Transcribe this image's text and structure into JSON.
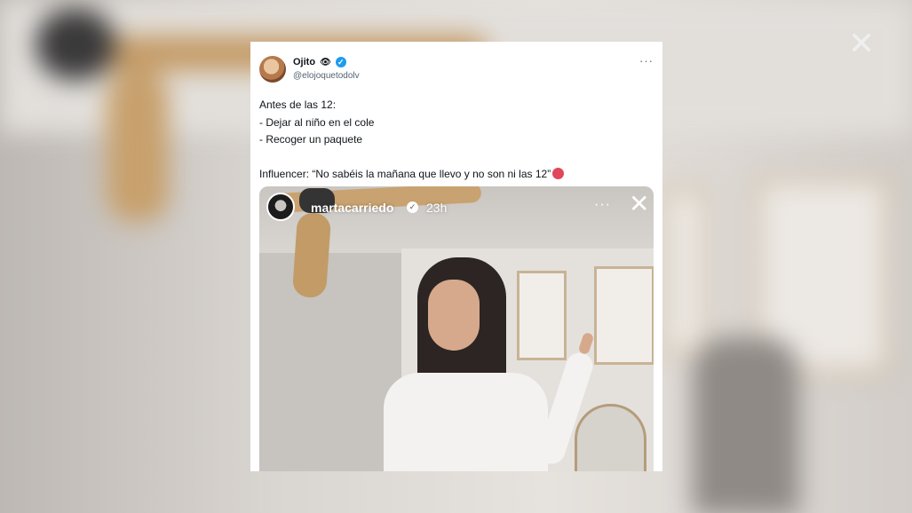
{
  "tweet": {
    "display_name": "Ojito",
    "name_emoji": "👁",
    "handle": "@elojoquetodolv",
    "more_label": "···",
    "lines": [
      "Antes de las 12:",
      "- Dejar al niño en el cole",
      "- Recoger un paquete"
    ],
    "quote_line": "Influencer: “No sabéis la mañana que llevo y no son ni las 12”"
  },
  "story": {
    "username": "martacarriedo",
    "time": "23h",
    "more_label": "···",
    "close_label": "✕"
  },
  "backdrop": {
    "close_label": "✕"
  },
  "colors": {
    "verified": "#1d9bf0",
    "text": "#0f1419",
    "secondary": "#536471"
  }
}
